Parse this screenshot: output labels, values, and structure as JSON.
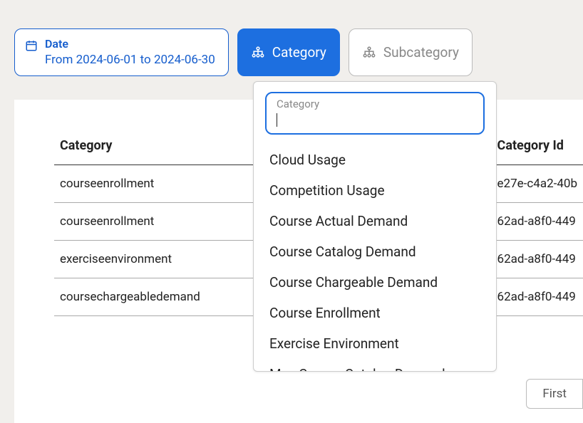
{
  "filters": {
    "date": {
      "label": "Date",
      "value": "From 2024-06-01 to 2024-06-30"
    },
    "category": {
      "label": "Category"
    },
    "subcategory": {
      "label": "Subcategory"
    }
  },
  "table": {
    "headers": {
      "category": "Category",
      "categoryId": "Category Id"
    },
    "rows": [
      {
        "category": "courseenrollment",
        "id": "e27e-c4a2-40b"
      },
      {
        "category": "courseenrollment",
        "id": "62ad-a8f0-449"
      },
      {
        "category": "exerciseenvironment",
        "id": "62ad-a8f0-449"
      },
      {
        "category": "coursechargeabledemand",
        "id": "62ad-a8f0-449"
      }
    ]
  },
  "dropdown": {
    "search_label": "Category",
    "search_value": "",
    "options": [
      "Cloud Usage",
      "Competition Usage",
      "Course Actual Demand",
      "Course Catalog Demand",
      "Course Chargeable Demand",
      "Course Enrollment",
      "Exercise Environment",
      "Max Course Catalog Demand"
    ]
  },
  "pagination": {
    "first": "First"
  }
}
